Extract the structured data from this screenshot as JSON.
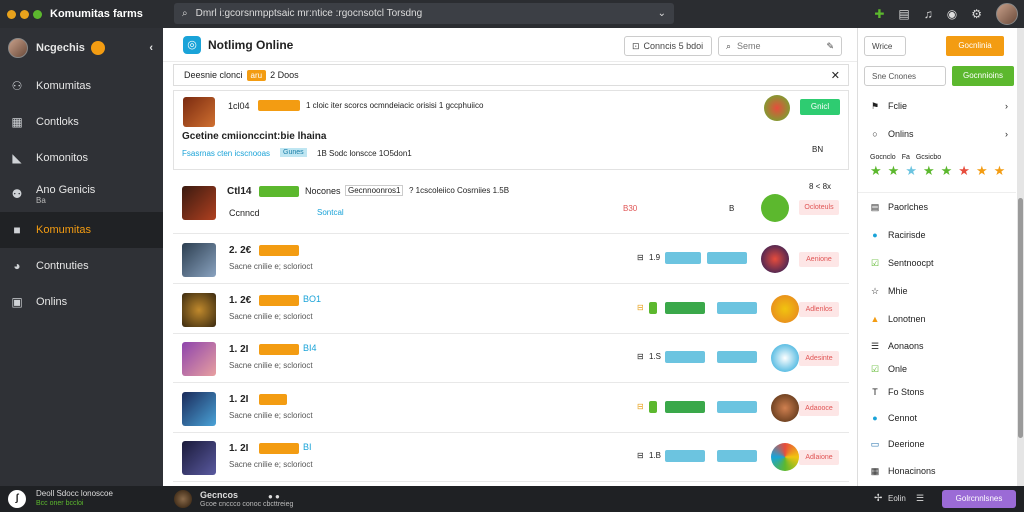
{
  "app": {
    "title": "Komumitas farms"
  },
  "search": {
    "value": "Dmrl i:gcorsnmpptsaic mr:ntice :rgocnsotcl Torsdng"
  },
  "sidebar": {
    "user_name": "Ncgechis",
    "items": [
      {
        "label": "Komumitas",
        "icon": "users-icon"
      },
      {
        "label": "Contloks",
        "icon": "layers-icon"
      },
      {
        "label": "Komonitos",
        "icon": "bookmark-icon"
      },
      {
        "label": "Ano Genicis",
        "sub": "Ba",
        "icon": "people-icon"
      },
      {
        "label": "Komumitas",
        "icon": "square-icon",
        "active": true
      },
      {
        "label": "Contnuties",
        "icon": "chat-icon"
      },
      {
        "label": "Onlins",
        "icon": "monitor-icon"
      }
    ]
  },
  "main": {
    "title": "Notlimg Online",
    "header_button": "Conncis 5 bdoi",
    "search_placeholder": "Seme",
    "filter_label": "Deesnie clonci",
    "filter_tag": "aru",
    "filter_suffix": "2 Doos"
  },
  "featured": {
    "score": "1cl04",
    "chip_label": "",
    "line": "1 cloic iter scorcs ocmndeiacic orisisi 1 gccphuiico",
    "heading": "Gcetine cmiionccint:bie lhaina",
    "meta": "Fsasrnas cten icscnooas",
    "meta_tag": "Gunes",
    "meta_tail": "1B  Sodc lonscce 1O5don1",
    "join_button": "Gnicl",
    "count": "BN"
  },
  "list_header": {
    "score": "Ctl14",
    "title": "Nocones",
    "title_tag": "Gecnnoonros1",
    "meta": "? 1cscoleiico Cosrniies 1.5B",
    "sub": "Ccnncd",
    "sub_tag": "Sontcal",
    "red_label": "B30",
    "mid": "B",
    "dots": "8 < 8x",
    "action": "Ocloteuls"
  },
  "rows": [
    {
      "score": "2. 2€",
      "tag": "",
      "sub": "Sacne cnilie e; sclorioct",
      "n": "1.9",
      "action": "Aenione"
    },
    {
      "score": "1. 2€",
      "tag": "BO1",
      "sub": "Sacne cnilie e; sclorioct",
      "n": "",
      "action": "Adlenlos"
    },
    {
      "score": "1. 2I",
      "tag": "BI4",
      "sub": "Sacne cnilie e; sclorioct",
      "n": "1.S",
      "action": "Adesinte"
    },
    {
      "score": "1. 2I",
      "tag": "",
      "sub": "Sacne cnilie e; sclorioct",
      "n": "",
      "action": "Adaooce"
    },
    {
      "score": "1. 2I",
      "tag": "BI",
      "sub": "Sacne cnilie e; sclorioct",
      "n": "1.B",
      "action": "Adlaione"
    }
  ],
  "right": {
    "top_button": "Wrice",
    "orange_button": "Gocnlinia",
    "input_placeholder": "Sne Cnones",
    "green_button": "Gocnnioins",
    "nav": [
      {
        "label": "Fclie"
      },
      {
        "label": "Onlins"
      }
    ],
    "rating_label": "Gocnclo",
    "rating_mid": "Fa",
    "rating_tail": "Gcsicbo",
    "items": [
      {
        "label": "Paorlches",
        "icon": "clipboard-icon"
      },
      {
        "label": "Racirisde",
        "icon": "circle-icon"
      },
      {
        "label": "Sentnoocpt",
        "icon": "check-icon"
      },
      {
        "label": "Mhie",
        "icon": "star-icon"
      },
      {
        "label": "Lonotnen",
        "icon": "lock-icon"
      },
      {
        "label": "Aonaons",
        "icon": "list-icon"
      },
      {
        "label": "Onle",
        "icon": "check-square-icon"
      },
      {
        "label": "Fo Stons",
        "icon": "text-icon"
      },
      {
        "label": "Cennot",
        "icon": "dot-icon"
      },
      {
        "label": "Deerione",
        "icon": "calendar-icon"
      },
      {
        "label": "Honacinons",
        "icon": "grid-icon"
      }
    ]
  },
  "bottom": {
    "user_status": "Deoll Sdocc lonoscoe",
    "user_sub": "Bcc oner bccloi",
    "channel": "Gecncos",
    "channel_sub": "Gcoe cnccco conoc cbcttreieg",
    "right_label": "Eolin",
    "purple_button": "Golrcnnlsnes"
  },
  "colors": {
    "accent": "#f39c12",
    "green": "#5cb82e",
    "blue": "#6cc4e0",
    "purple": "#9b6bd6"
  }
}
